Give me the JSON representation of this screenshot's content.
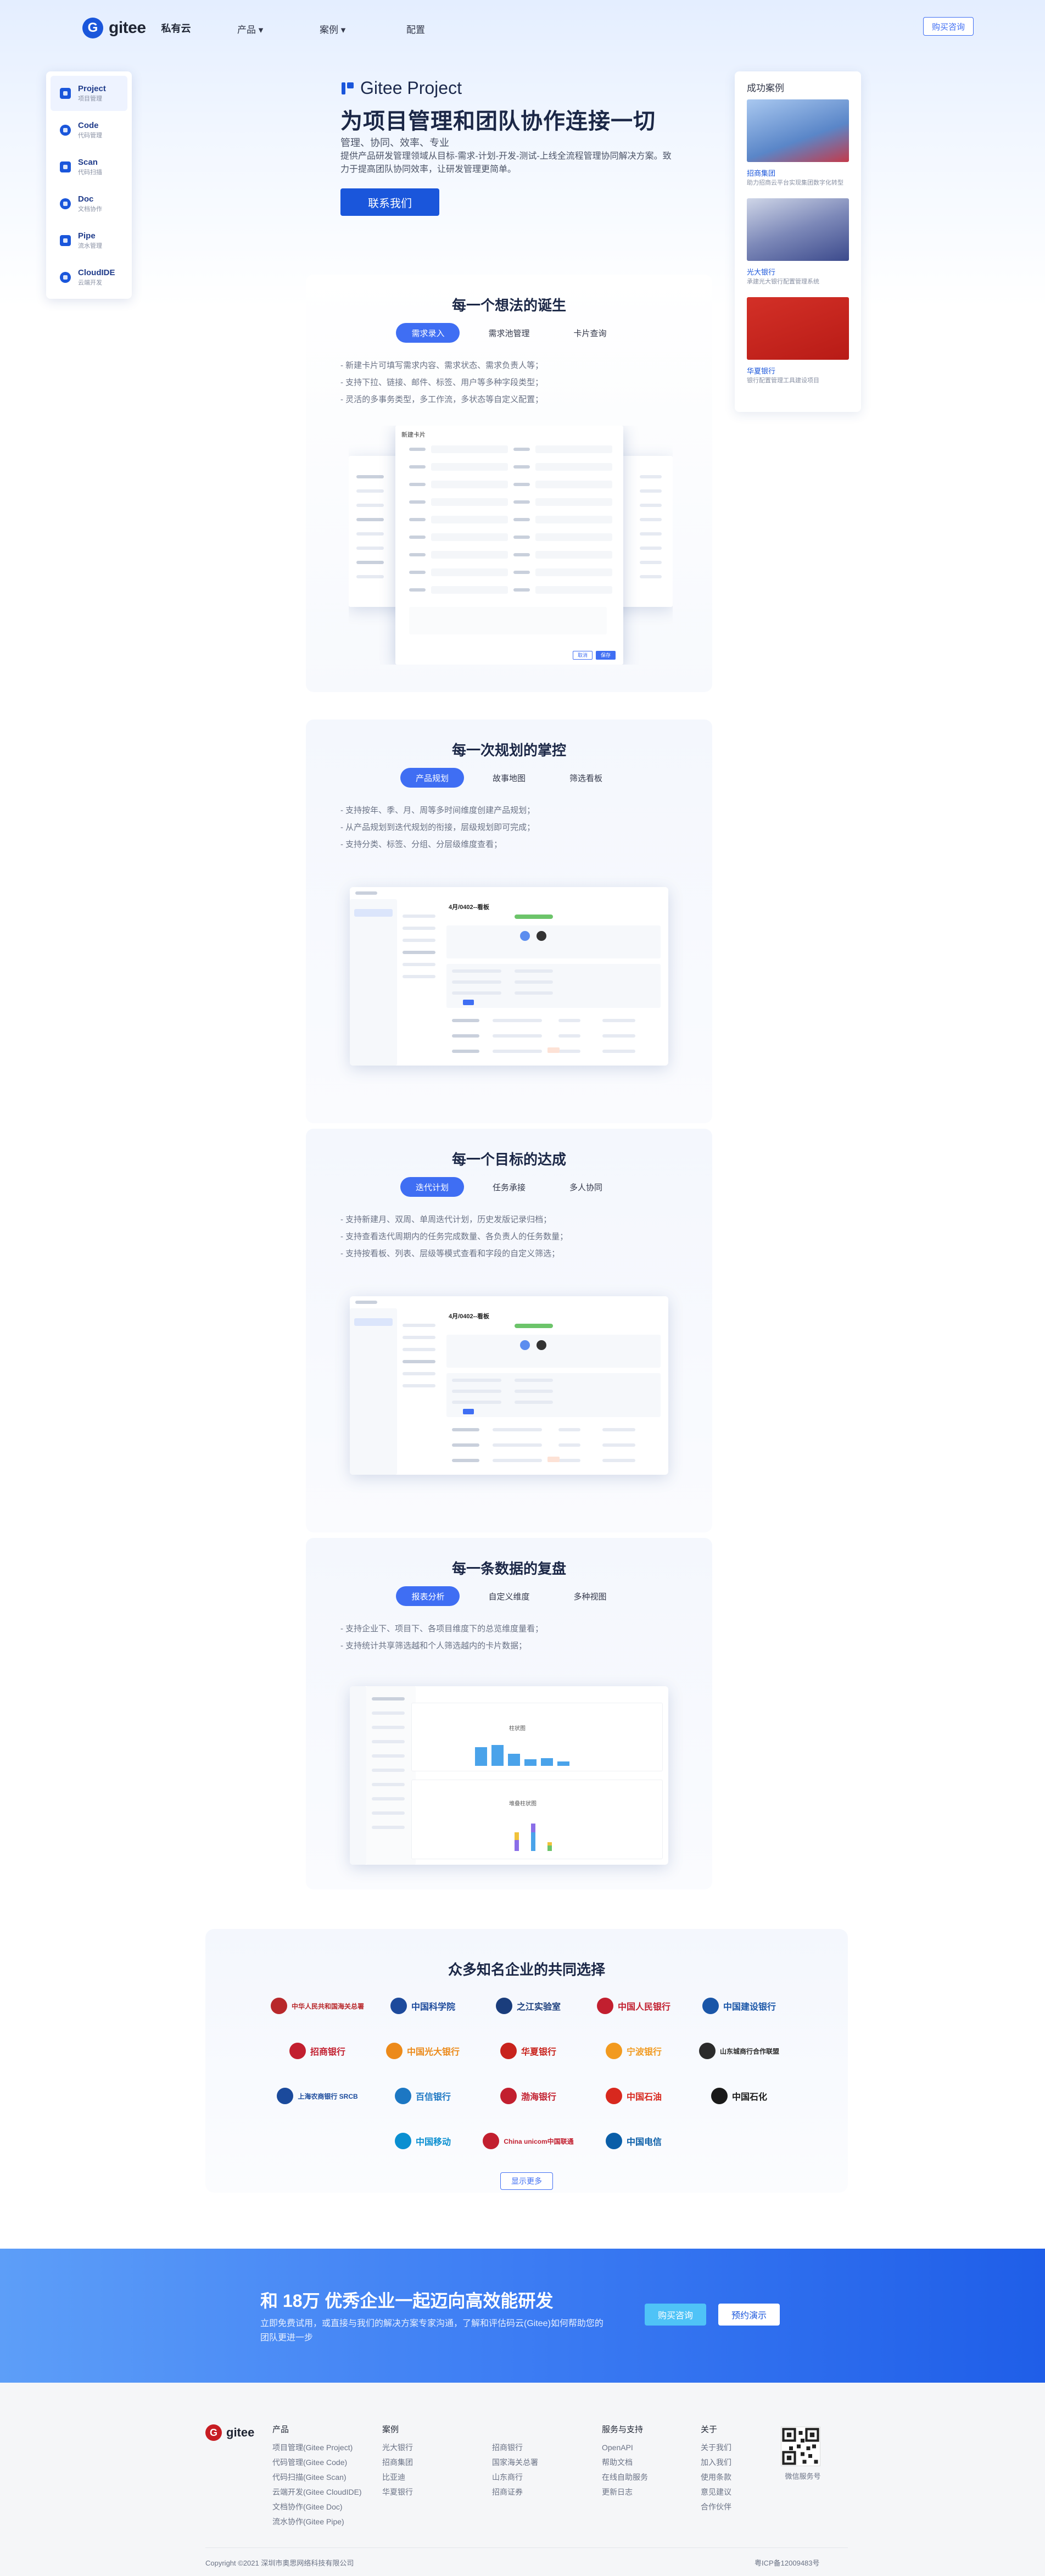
{
  "nav": {
    "logo_text": "gitee",
    "product_line": "私有云",
    "items": [
      "产品",
      "案例",
      "配置"
    ],
    "buy_label": "购买咨询"
  },
  "sidebar": {
    "items": [
      {
        "name": "Project",
        "desc": "项目管理",
        "icon": "project-icon",
        "color": "#1a56db"
      },
      {
        "name": "Code",
        "desc": "代码管理",
        "icon": "code-icon",
        "color": "#1a56db"
      },
      {
        "name": "Scan",
        "desc": "代码扫描",
        "icon": "scan-icon",
        "color": "#1a56db"
      },
      {
        "name": "Doc",
        "desc": "文档协作",
        "icon": "doc-icon",
        "color": "#1a56db"
      },
      {
        "name": "Pipe",
        "desc": "流水管理",
        "icon": "pipe-icon",
        "color": "#1a56db"
      },
      {
        "name": "CloudIDE",
        "desc": "云端开发",
        "icon": "cloudide-icon",
        "color": "#1a56db"
      }
    ]
  },
  "hero": {
    "brand": "Gitee Project",
    "title": "为项目管理和团队协作连接一切",
    "keywords": "管理、协同、效率、专业",
    "desc": "提供产品研发管理领域从目标-需求-计划-开发-测试-上线全流程管理协同解决方案。致力于提高团队协同效率，让研发管理更简单。",
    "cta": "联系我们"
  },
  "cases": {
    "title": "成功案例",
    "items": [
      {
        "name": "招商集团",
        "desc": "助力招商云平台实现集团数字化转型",
        "color": "#c52a3a"
      },
      {
        "name": "光大银行",
        "desc": "承建光大银行配置管理系统",
        "color": "#6b76a8"
      },
      {
        "name": "华夏银行",
        "desc": "银行配置管理工具建设项目",
        "color": "#c8231d"
      }
    ]
  },
  "sections": [
    {
      "title": "每一个想法的诞生",
      "tabs": [
        "需求录入",
        "需求池管理",
        "卡片查询"
      ],
      "bullets": [
        "- 新建卡片可填写需求内容、需求状态、需求负责人等；",
        "- 支持下拉、链接、邮件、标签、用户等多种字段类型；",
        "- 灵活的多事务类型，多工作流，多状态等自定义配置；"
      ],
      "mock": {
        "dialog_title": "新建卡片",
        "save": "保存",
        "cancel": "取消"
      }
    },
    {
      "title": "每一次规划的掌控",
      "tabs": [
        "产品规划",
        "故事地图",
        "筛选看板"
      ],
      "bullets": [
        "- 支持按年、季、月、周等多时间维度创建产品规划；",
        "- 从产品规划到迭代规划的衔接，层级规划即可完成；",
        "- 支持分类、标签、分组、分层级维度查看；"
      ],
      "mock": {
        "sprint_title": "4月/0402--看板"
      }
    },
    {
      "title": "每一个目标的达成",
      "tabs": [
        "迭代计划",
        "任务承接",
        "多人协同"
      ],
      "bullets": [
        "- 支持新建月、双周、单周迭代计划，历史发版记录归档；",
        "- 支持查看迭代周期内的任务完成数量、各负责人的任务数量；",
        "- 支持按看板、列表、层级等模式查看和字段的自定义筛选；"
      ],
      "mock": {
        "sprint_title": "4月/0402--看板"
      }
    },
    {
      "title": "每一条数据的复盘",
      "tabs": [
        "报表分析",
        "自定义维度",
        "多种视图"
      ],
      "bullets": [
        "- 支持企业下、项目下、各项目维度下的总览维度量看；",
        "- 支持统计共享筛选越和个人筛选越内的卡片数据；"
      ],
      "mock": {
        "chart1_title": "柱状图",
        "chart2_title": "堆叠柱状图"
      }
    }
  ],
  "clients": {
    "title": "众多知名企业的共同选择",
    "logos": [
      {
        "name": "中华人民共和国海关总署",
        "color": "#b8282b",
        "icon": "customs-icon"
      },
      {
        "name": "中国科学院",
        "color": "#1d4a9c",
        "icon": "cas-icon"
      },
      {
        "name": "之江实验室",
        "color": "#1a3d7c",
        "icon": "zhejianglab-icon"
      },
      {
        "name": "中国人民银行",
        "color": "#c21f2f",
        "icon": "pbc-icon"
      },
      {
        "name": "中国建设银行",
        "color": "#1a56a8",
        "icon": "ccb-icon"
      },
      {
        "name": "招商银行",
        "color": "#c21f2f",
        "icon": "cmb-icon"
      },
      {
        "name": "中国光大银行",
        "color": "#ec8a1a",
        "icon": "ceb-icon"
      },
      {
        "name": "华夏银行",
        "color": "#c8231d",
        "icon": "hxb-icon"
      },
      {
        "name": "宁波银行",
        "color": "#f29a1f",
        "icon": "nbcb-icon"
      },
      {
        "name": "山东城商行合作联盟",
        "color": "#2b2b2b",
        "icon": "sdcb-icon"
      },
      {
        "name": "上海农商银行 SRCB",
        "color": "#1b4a9c",
        "icon": "srcb-icon"
      },
      {
        "name": "百信银行",
        "color": "#1c77c3",
        "icon": "aibank-icon"
      },
      {
        "name": "渤海银行",
        "color": "#c21f2f",
        "icon": "cbhb-icon"
      },
      {
        "name": "中国石油",
        "color": "#d8281e",
        "icon": "petrochina-icon"
      },
      {
        "name": "中国石化",
        "color": "#1a1a1a",
        "icon": "sinopec-icon"
      },
      {
        "name": "中国移动",
        "color": "#0a8fd1",
        "icon": "chinamobile-icon"
      },
      {
        "name": "China unicom中国联通",
        "color": "#c21f2f",
        "icon": "unicom-icon"
      },
      {
        "name": "中国电信",
        "color": "#0a5ea8",
        "icon": "chinatelecom-icon"
      }
    ],
    "more_label": "显示更多"
  },
  "cta": {
    "title": "和 18万 优秀企业一起迈向高效能研发",
    "desc": "立即免费试用，或直接与我们的解决方案专家沟通，了解和评估码云(Gitee)如何帮助您的团队更进一步",
    "btn_primary": "购买咨询",
    "btn_secondary": "预约演示"
  },
  "footer": {
    "logo_text": "gitee",
    "columns": [
      {
        "title": "产品",
        "items": [
          "项目管理(Gitee Project)",
          "代码管理(Gitee Code)",
          "代码扫描(Gitee Scan)",
          "云端开发(Gitee CloudIDE)",
          "文档协作(Gitee Doc)",
          "流水协作(Gitee Pipe)"
        ]
      },
      {
        "title": "案例",
        "items": [
          "光大银行",
          "招商集团",
          "比亚迪",
          "华夏银行"
        ]
      },
      {
        "title": "",
        "items": [
          "招商银行",
          "国家海关总署",
          "山东商行",
          "招商证券"
        ]
      },
      {
        "title": "服务与支持",
        "items": [
          "OpenAPI",
          "帮助文档",
          "在线自助服务",
          "更新日志"
        ]
      },
      {
        "title": "关于",
        "items": [
          "关于我们",
          "加入我们",
          "使用条款",
          "意见建议",
          "合作伙伴"
        ]
      }
    ],
    "qr_label": "微信服务号",
    "copyright": "Copyright ©2021 深圳市奥思网络科技有限公司",
    "icp": "粤ICP备12009483号"
  }
}
